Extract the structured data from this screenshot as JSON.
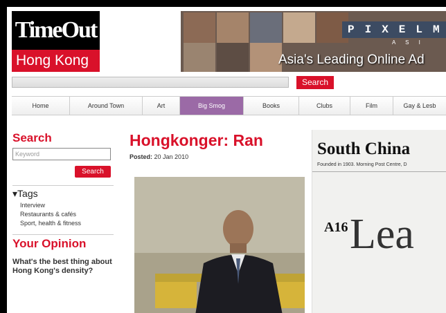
{
  "logo": {
    "top": "TimeOut",
    "bottom": "Hong Kong"
  },
  "banner": {
    "brand": "PIXELM",
    "sub": "A S I",
    "tagline": "Asia's Leading Online Ad"
  },
  "search_bar": {
    "button": "Search"
  },
  "nav": [
    {
      "label": "Home"
    },
    {
      "label": "Around Town"
    },
    {
      "label": "Art"
    },
    {
      "label": "Big Smog",
      "active": true
    },
    {
      "label": "Books"
    },
    {
      "label": "Clubs"
    },
    {
      "label": "Film"
    },
    {
      "label": "Gay & Lesb"
    }
  ],
  "left": {
    "search_title": "Search",
    "keyword_placeholder": "Keyword",
    "search_button": "Search",
    "tags_title": "Tags",
    "tags_marker": "▾",
    "tags": [
      "Interview",
      "Restaurants & cafés",
      "Sport, health & fitness"
    ],
    "opinion_title": "Your Opinion",
    "question": "What's the best thing about Hong Kong's density?"
  },
  "article": {
    "headline": "Hongkonger: Ran",
    "posted_label": "Posted:",
    "posted_date": "20 Jan 2010"
  },
  "clipping": {
    "title": "South China",
    "subtitle": "Founded in 1903. Morning Post Centre, D",
    "page": "A16",
    "big_text": "Lea"
  },
  "colors": {
    "brand_red": "#d9112a",
    "nav_active": "#9b6aa6"
  }
}
